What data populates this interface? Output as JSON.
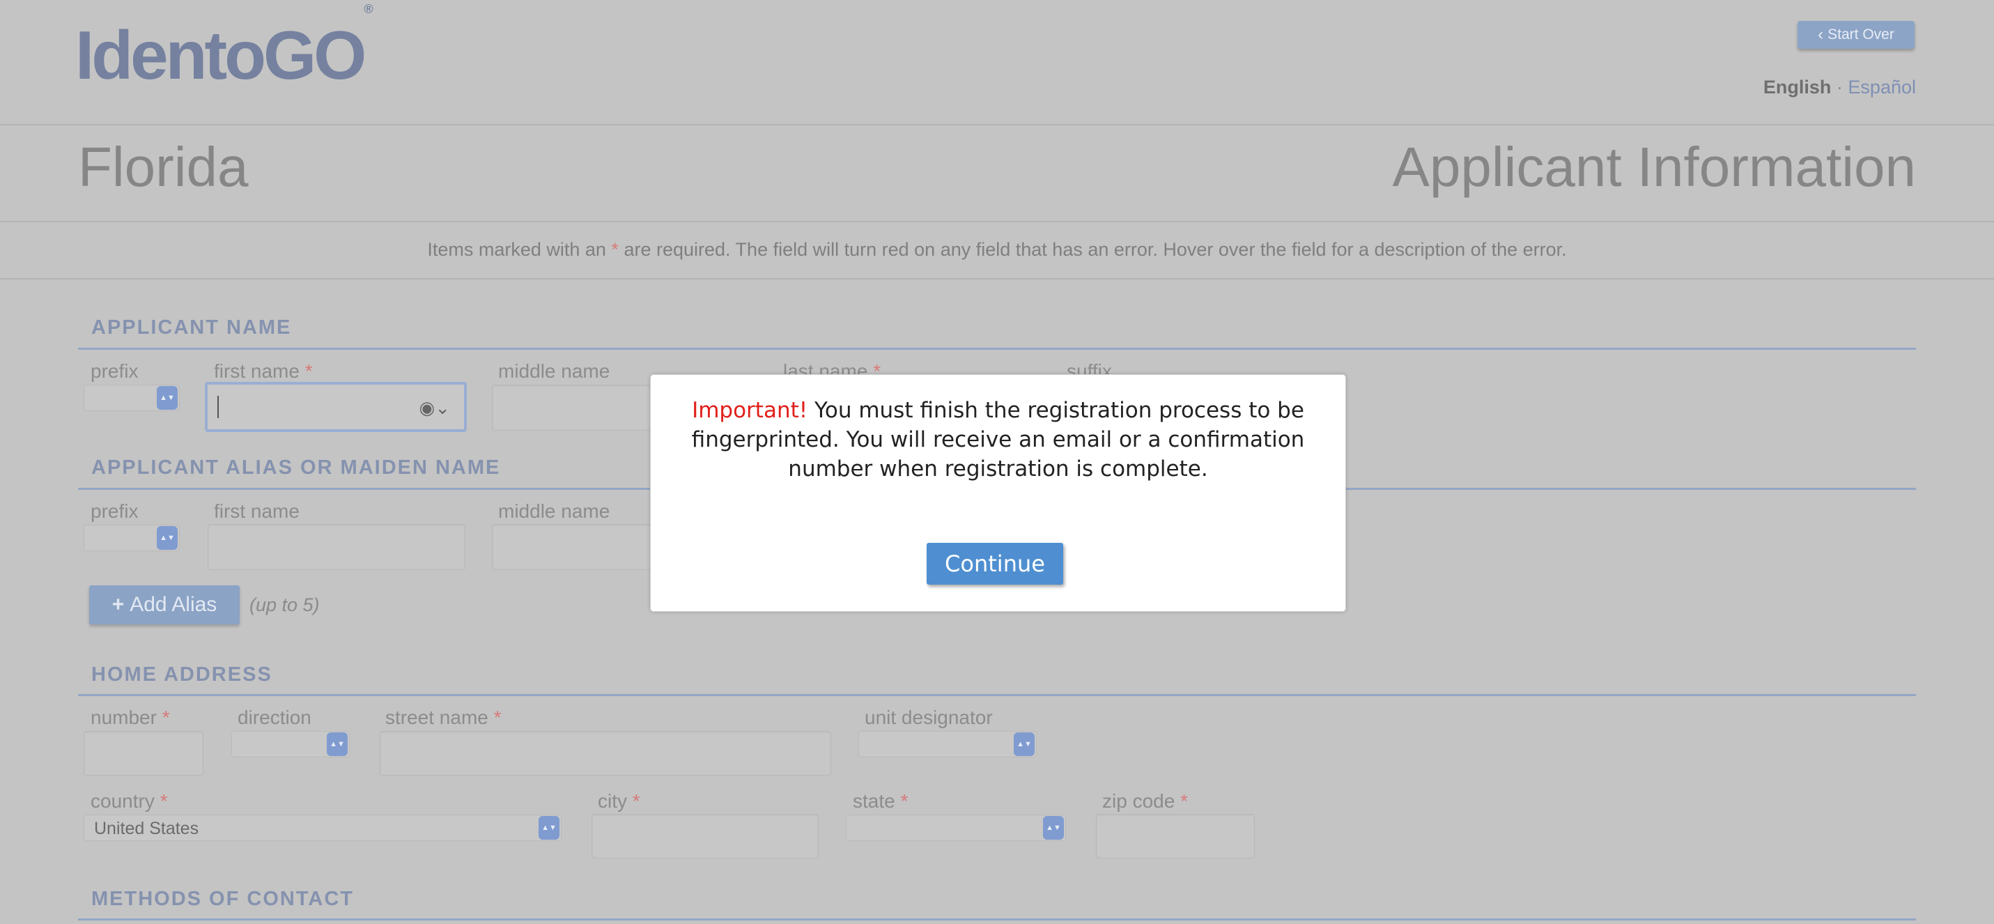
{
  "header": {
    "logo": "IdentoGO",
    "logo_mark": "®",
    "start_over": "Start Over",
    "lang_current": "English",
    "lang_sep": "·",
    "lang_alt": "Español"
  },
  "page": {
    "state": "Florida",
    "title": "Applicant Information",
    "notice_pre": "Items marked with an",
    "notice_star": "*",
    "notice_post": "are required. The field will turn red on any field that has an error. Hover over the field for a description of the error."
  },
  "applicant_name": {
    "heading": "APPLICANT NAME",
    "prefix": "prefix",
    "first": "first name",
    "middle": "middle name",
    "last": "last name",
    "suffix": "suffix",
    "star": "*"
  },
  "alias": {
    "heading": "APPLICANT ALIAS OR MAIDEN NAME",
    "prefix": "prefix",
    "first": "first name",
    "middle": "middle name",
    "add_button": "Add Alias",
    "add_icon": "+",
    "limit": "(up to 5)"
  },
  "home_address": {
    "heading": "HOME ADDRESS",
    "number": "number",
    "direction": "direction",
    "street": "street name",
    "unit": "unit designator",
    "country": "country",
    "country_value": "United States",
    "city": "city",
    "state": "state",
    "zip": "zip code",
    "star": "*"
  },
  "contact": {
    "heading": "METHODS OF CONTACT"
  },
  "modal": {
    "important": "Important!",
    "message": "You must finish the registration process to be fingerprinted. You will receive an email or a confirmation number when registration is complete.",
    "continue": "Continue"
  },
  "colors": {
    "accent": "#4f8fd1",
    "important": "#e0201b",
    "overlay": "#c4c4c4"
  }
}
